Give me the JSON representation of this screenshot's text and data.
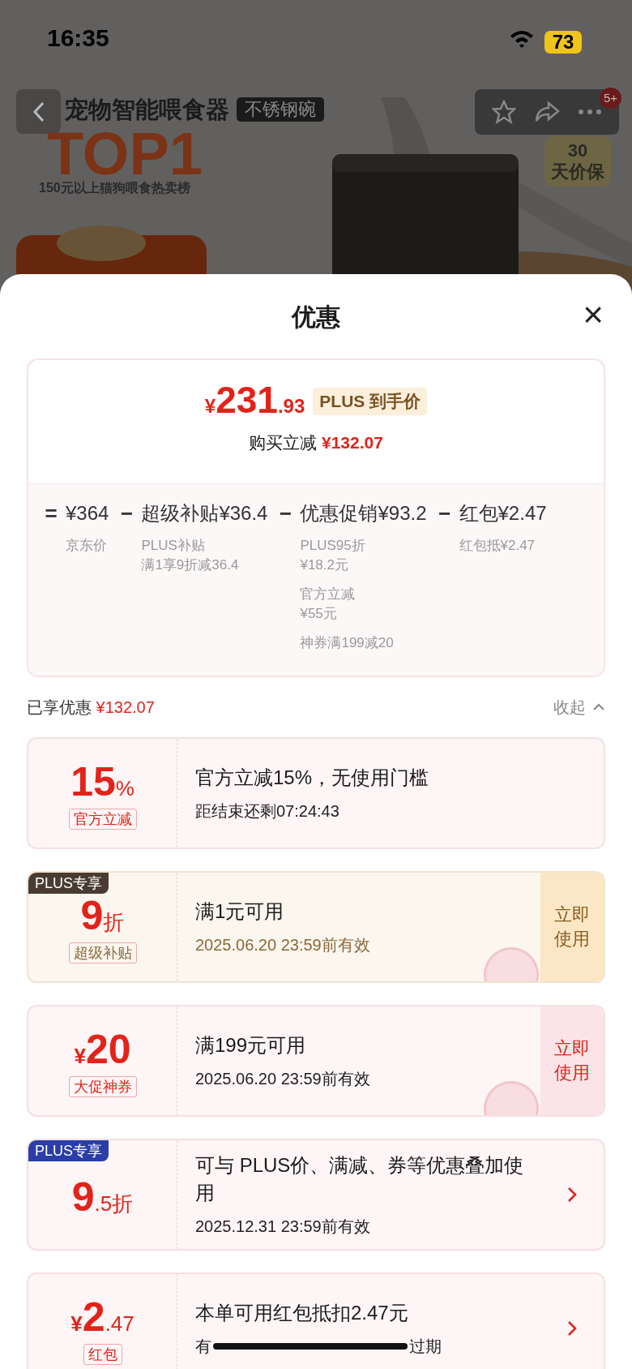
{
  "status_bar": {
    "time": "16:35",
    "battery": "73"
  },
  "product_page": {
    "title": "宠物智能喂食器",
    "title_tag": "不锈钢碗",
    "rank_title": "TOP1",
    "rank_caption": "150元以上猫狗喂食热卖榜",
    "guarantee_badge": "30天价保",
    "notification_count": "5+"
  },
  "sheet": {
    "title": "优惠",
    "close": "×"
  },
  "price_summary": {
    "currency": "¥",
    "price_main": "231",
    "price_decimal": ".93",
    "price_tag": "PLUS 到手价",
    "saving_label": "购买立减",
    "saving_amount": "¥132.07",
    "breakdown": [
      {
        "operator": "=",
        "amount": "¥364",
        "notes": [
          [
            "京东价"
          ]
        ]
      },
      {
        "operator": "−",
        "label": "超级补贴",
        "amount": "¥36.4",
        "notes": [
          [
            "PLUS补贴",
            "满1享9折减36.4"
          ]
        ]
      },
      {
        "operator": "−",
        "label": "优惠促销",
        "amount": "¥93.2",
        "notes": [
          [
            "PLUS95折",
            "¥18.2元"
          ],
          [
            "官方立减",
            "¥55元"
          ],
          [
            "神券满199减20"
          ]
        ]
      },
      {
        "operator": "−",
        "label": "红包",
        "amount": "¥2.47",
        "notes": [
          [
            "红包抵¥2.47"
          ]
        ]
      }
    ]
  },
  "applied": {
    "label": "已享优惠",
    "amount": "¥132.07",
    "toggle": "收起",
    "expanded": true
  },
  "coupons": [
    {
      "color": "#fdf5f6",
      "amount": "15",
      "suffix": "%",
      "tag": "官方立减",
      "title": "官方立减15%，无使用门槛",
      "subtitle": "距结束还剩07:24:43",
      "kind": "plain",
      "claimed": false
    },
    {
      "color": "#fbf6ee",
      "badge": {
        "text": "PLUS专享",
        "color": "#4a3b32"
      },
      "amount": "9",
      "suffix": "折",
      "tag": "超级补贴",
      "title": "满1元可用",
      "subtitle": "2025.06.20 23:59前有效",
      "kind": "action",
      "action": "立即使用",
      "claimed": true
    },
    {
      "color": "#fdf5f6",
      "prefix": "¥",
      "amount": "20",
      "tag": "大促神券",
      "title": "满199元可用",
      "subtitle": "2025.06.20 23:59前有效",
      "kind": "action",
      "action": "立即使用",
      "claimed": true
    },
    {
      "color": "#fdf5f6",
      "badge": {
        "text": "PLUS专享",
        "color": "#2b3ea8"
      },
      "amount": "9",
      "suffix": ".5折",
      "title": "可与 PLUS价、满减、券等优惠叠加使用",
      "subtitle": "2025.12.31 23:59前有效",
      "kind": "chevron",
      "claimed": false
    },
    {
      "color": "#fdf5f6",
      "prefix": "¥",
      "amount": "2",
      "suffix": ".47",
      "tag": "红包",
      "title": "本单可用红包抵扣2.47元",
      "subtitle_start": "有",
      "subtitle_end": "过期",
      "subtitle_redacted": true,
      "kind": "chevron",
      "claimed": false
    }
  ]
}
